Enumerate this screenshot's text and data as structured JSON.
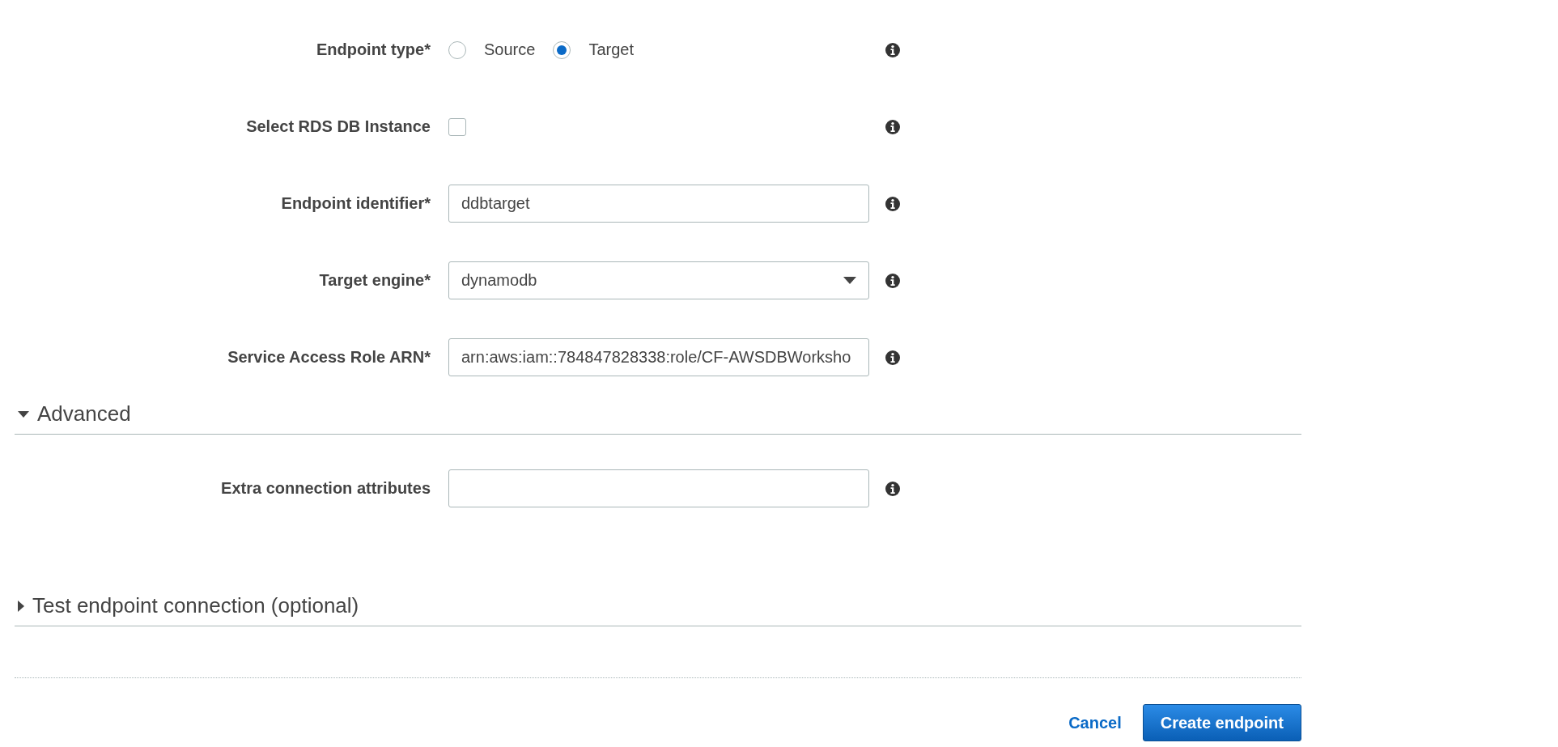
{
  "fields": [
    {
      "kind": "radio",
      "label": "Endpoint type*",
      "options": [
        {
          "label": "Source",
          "selected": false
        },
        {
          "label": "Target",
          "selected": true
        }
      ]
    },
    {
      "kind": "checkbox",
      "label": "Select RDS DB Instance",
      "checked": false
    },
    {
      "kind": "text",
      "label": "Endpoint identifier*",
      "value": "ddbtarget"
    },
    {
      "kind": "select",
      "label": "Target engine*",
      "value": "dynamodb"
    },
    {
      "kind": "text",
      "label": "Service Access Role ARN*",
      "value": "arn:aws:iam::784847828338:role/CF-AWSDBWorksho"
    }
  ],
  "advanced": {
    "title": "Advanced",
    "expanded": true,
    "fields": [
      {
        "kind": "text",
        "label": "Extra connection attributes"
      }
    ]
  },
  "test_connection": {
    "title": "Test endpoint connection (optional)",
    "expanded": false
  },
  "buttons": {
    "cancel": "Cancel",
    "create": "Create endpoint"
  }
}
